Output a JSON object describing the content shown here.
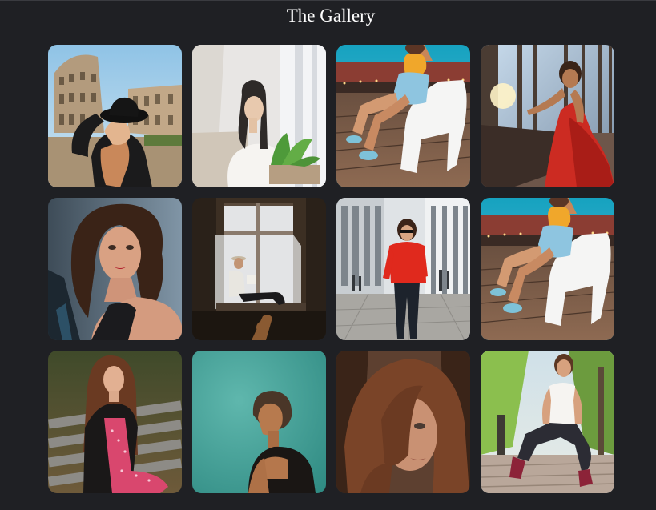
{
  "header": {
    "title": "The Gallery"
  },
  "gallery": {
    "photos": [
      {
        "subject": "woman-black-hat-colosseum"
      },
      {
        "subject": "woman-white-room-plant"
      },
      {
        "subject": "woman-yellow-top-white-chair"
      },
      {
        "subject": "woman-red-dress-forest"
      },
      {
        "subject": "woman-portrait-brunette"
      },
      {
        "subject": "man-reading-window"
      },
      {
        "subject": "woman-red-sweater-city"
      },
      {
        "subject": "woman-yellow-top-white-chair"
      },
      {
        "subject": "woman-leather-jacket-bench"
      },
      {
        "subject": "woman-teal-background"
      },
      {
        "subject": "woman-closeup-hair"
      },
      {
        "subject": "woman-sitting-steps-park"
      }
    ]
  }
}
